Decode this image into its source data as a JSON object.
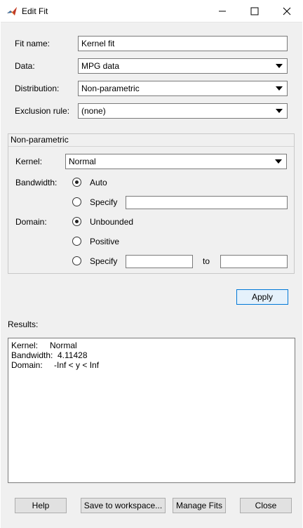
{
  "window": {
    "title": "Edit Fit",
    "controls": [
      "minimize-icon",
      "maximize-icon",
      "close-icon"
    ]
  },
  "form": {
    "fit_name_label": "Fit name:",
    "fit_name_value": "Kernel fit",
    "data_label": "Data:",
    "data_value": "MPG data",
    "distribution_label": "Distribution:",
    "distribution_value": "Non-parametric",
    "exclusion_label": "Exclusion rule:",
    "exclusion_value": "(none)"
  },
  "nonparametric": {
    "title": "Non-parametric",
    "kernel_label": "Kernel:",
    "kernel_value": "Normal",
    "bandwidth_label": "Bandwidth:",
    "bandwidth_auto": "Auto",
    "bandwidth_specify": "Specify",
    "bandwidth_selected": "Auto",
    "bandwidth_value": "",
    "domain_label": "Domain:",
    "domain_unbounded": "Unbounded",
    "domain_positive": "Positive",
    "domain_specify": "Specify",
    "domain_selected": "Unbounded",
    "domain_from": "",
    "domain_to_label": "to",
    "domain_to": ""
  },
  "apply_label": "Apply",
  "results": {
    "label": "Results:",
    "kernel_key": "Kernel:",
    "kernel_val": "Normal",
    "bandwidth_key": "Bandwidth:",
    "bandwidth_val": "4.11428",
    "domain_key": "Domain:",
    "domain_val": "-Inf < y < Inf"
  },
  "footer": {
    "help": "Help",
    "save": "Save to workspace...",
    "manage": "Manage Fits",
    "close": "Close"
  }
}
